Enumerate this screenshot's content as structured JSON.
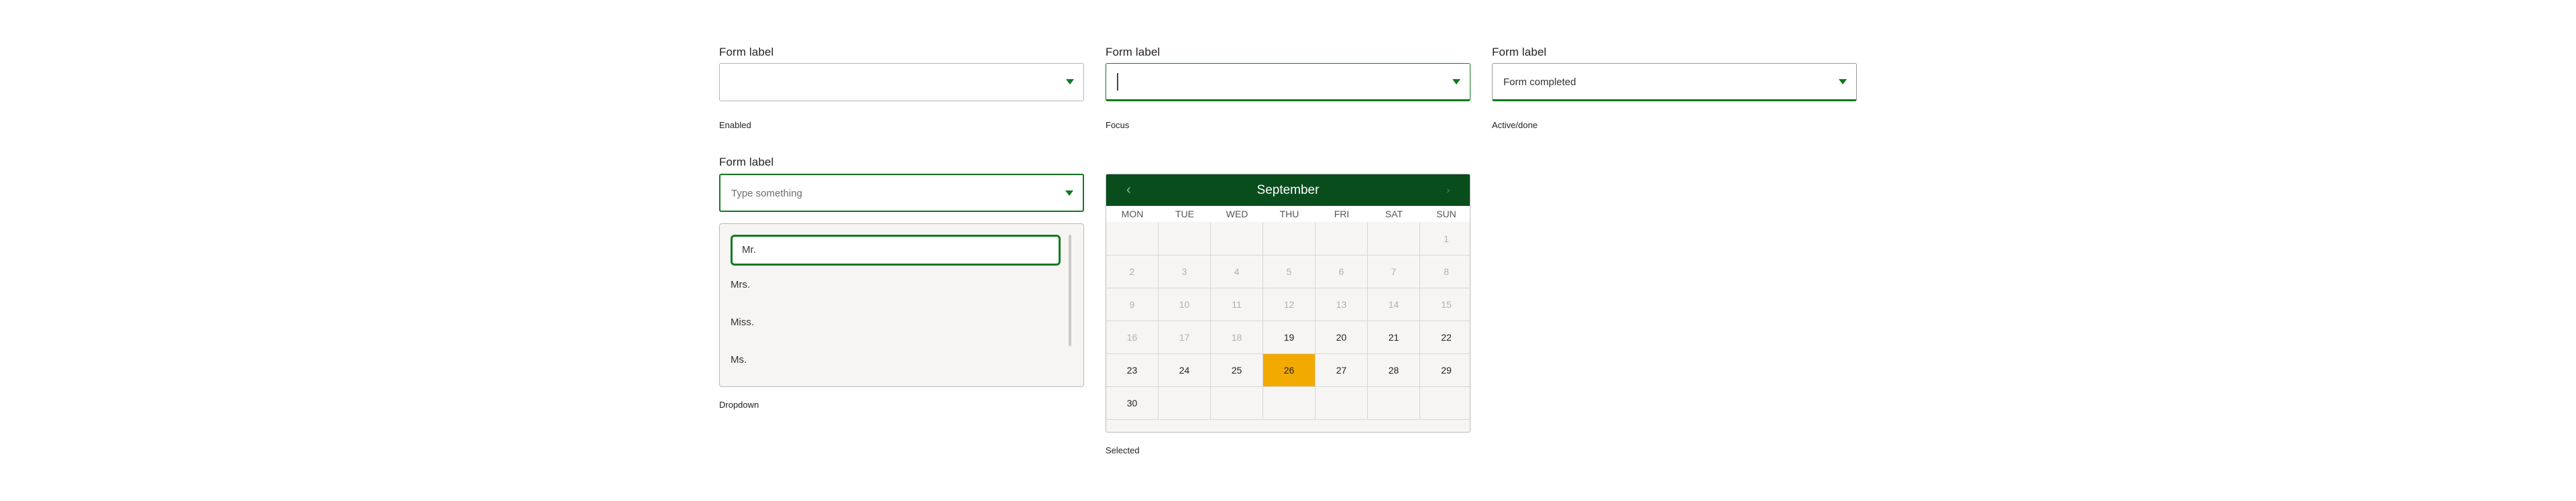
{
  "fields": [
    {
      "label": "Form label",
      "value": "",
      "caption": "Enabled"
    },
    {
      "label": "Form label",
      "value": "",
      "caption": "Focus"
    },
    {
      "label": "Form label",
      "value": "Form completed",
      "caption": "Active/done"
    }
  ],
  "dropdown": {
    "label": "Form label",
    "placeholder": "Type something",
    "options": [
      "Mr.",
      "Mrs.",
      "Miss.",
      "Ms."
    ],
    "selected": "Mr.",
    "caption": "Dropdown"
  },
  "calendar": {
    "month": "September",
    "prev_icon": "chevron-left-icon",
    "next_icon": "chevron-right-icon",
    "weekdays": [
      "MON",
      "TUE",
      "WED",
      "THU",
      "FRI",
      "SAT",
      "SUN"
    ],
    "weeks": [
      [
        "",
        "",
        "",
        "",
        "",
        "",
        "1"
      ],
      [
        "2",
        "3",
        "4",
        "5",
        "6",
        "7",
        "8"
      ],
      [
        "9",
        "10",
        "11",
        "12",
        "13",
        "14",
        "15"
      ],
      [
        "16",
        "17",
        "18",
        "19",
        "20",
        "21",
        "22"
      ],
      [
        "23",
        "24",
        "25",
        "26",
        "27",
        "28",
        "29"
      ],
      [
        "30",
        "",
        "",
        "",
        "",
        "",
        ""
      ]
    ],
    "first_available_day": 19,
    "selected_day": "26",
    "caption": "Selected"
  },
  "colors": {
    "accent_green": "#0f7a1f",
    "calendar_header": "#0a4d1c",
    "selected_day": "#f2a900"
  }
}
